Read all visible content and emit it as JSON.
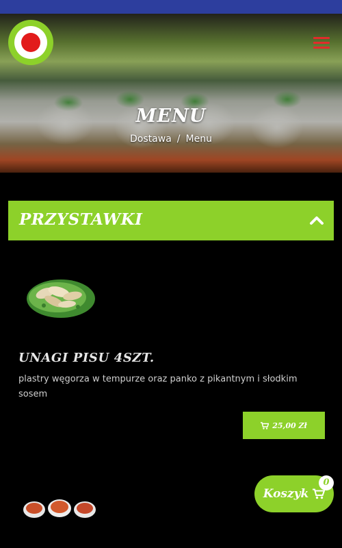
{
  "header": {
    "title": "MENU",
    "breadcrumb": {
      "home": "Dostawa",
      "separator": "/",
      "current": "Menu"
    }
  },
  "category": {
    "title": "PRZYSTAWKI",
    "expanded": true
  },
  "products": [
    {
      "name": "UNAGI PISU 4SZT.",
      "description": "plastry węgorza w tempurze oraz panko z pikantnym i słodkim sosem",
      "price": "25,00 Zł"
    }
  ],
  "cart": {
    "label": "Koszyk",
    "count": "0"
  },
  "colors": {
    "accent": "#8dd12a",
    "menu_icon": "#e22b2b",
    "status_bar": "#2d3e9e",
    "background": "#000000"
  },
  "icons": {
    "logo": "logo-icon",
    "menu": "hamburger-menu-icon",
    "collapse": "chevron-up-icon",
    "price_cart": "cart-icon",
    "cart": "cart-icon"
  }
}
